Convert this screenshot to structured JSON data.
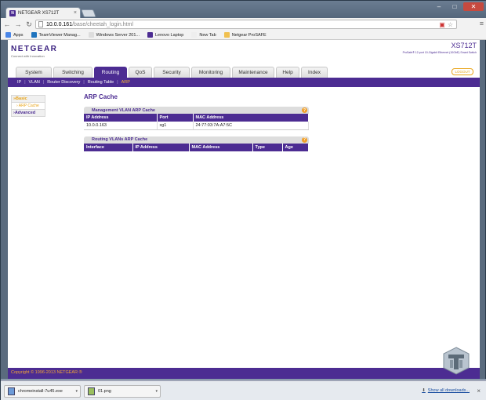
{
  "browser": {
    "tab_title": "NETGEAR XS712T",
    "tab_favicon_letter": "N",
    "url_host": "10.0.0.161",
    "url_path": "/base/cheetah_login.html",
    "bookmarks": [
      {
        "label": "Apps",
        "color": "#4a86e8"
      },
      {
        "label": "TeamViewer Manag...",
        "color": "#1e73be"
      },
      {
        "label": "Windows Server 201...",
        "color": "#dddddd"
      },
      {
        "label": "Lenovo Laptop",
        "color": "#4c2c92"
      },
      {
        "label": "New Tab",
        "color": "#eeeeee"
      },
      {
        "label": "Netgear ProSAFE",
        "color": "#f0c050"
      }
    ]
  },
  "header": {
    "logo": "NETGEAR",
    "logo_tagline": "Connect with Innovation",
    "model": "XS712T",
    "model_desc": "ProSafe® 12-port 10-Gigabit Ethernet (10GbE) Smart Switch",
    "logout_label": "LOGOUT"
  },
  "nav": {
    "tabs": [
      {
        "label": "System",
        "w": 46
      },
      {
        "label": "Switching",
        "w": 50
      },
      {
        "label": "Routing",
        "w": 42,
        "active": true
      },
      {
        "label": "QoS",
        "w": 30
      },
      {
        "label": "Security",
        "w": 46
      },
      {
        "label": "Monitoring",
        "w": 50
      },
      {
        "label": "Maintenance",
        "w": 54
      },
      {
        "label": "Help",
        "w": 30
      },
      {
        "label": "Index",
        "w": 34
      }
    ],
    "subtabs": [
      "IP",
      "VLAN",
      "Router Discovery",
      "Routing Table",
      "ARP"
    ],
    "active_subtab": "ARP"
  },
  "sidebar": {
    "basic": "»Basic",
    "arp_cache": "› ARP Cache",
    "advanced": "›Advanced"
  },
  "main": {
    "title": "ARP Cache",
    "mgmt_panel": {
      "title": "Management VLAN ARP Cache",
      "columns": [
        "IP Address",
        "Port",
        "MAC Address"
      ],
      "rows": [
        [
          "10.0.0.163",
          "xg1",
          "24:77:03:7A:A7:5C"
        ]
      ]
    },
    "routing_panel": {
      "title": "Routing VLANs ARP Cache",
      "columns": [
        "Interface",
        "IP Address",
        "MAC Address",
        "Type",
        "Age"
      ]
    }
  },
  "footer": {
    "copyright": "Copyright © 1996-2013 NETGEAR ®"
  },
  "downloads": {
    "items": [
      "chromeinstall-7u45.exe",
      "01.png"
    ],
    "show_all": "Show all downloads..."
  },
  "colors": {
    "brand_purple": "#4c2c92",
    "accent_orange": "#e8a316"
  }
}
